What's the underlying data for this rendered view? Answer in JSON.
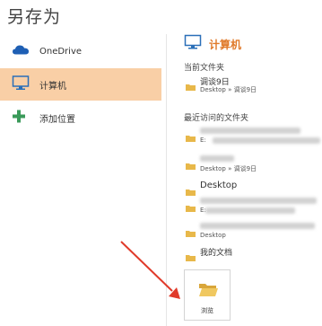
{
  "dialog": {
    "title": "另存为"
  },
  "locations": [
    {
      "label": "OneDrive",
      "icon": "cloud-icon"
    },
    {
      "label": "计算机",
      "icon": "computer-icon",
      "selected": true
    },
    {
      "label": "添加位置",
      "icon": "plus-icon"
    }
  ],
  "right": {
    "header": "计算机",
    "current_label": "当前文件夹",
    "current": {
      "name": "调谈9日",
      "path": "Desktop » 调谈9日"
    },
    "recent_label": "最近访问的文件夹",
    "recent": [
      {
        "name": "",
        "path": "E:"
      },
      {
        "name": "",
        "path": "Desktop » 调谈9日"
      },
      {
        "name": "Desktop",
        "path": ""
      },
      {
        "name": "",
        "path": "E:"
      },
      {
        "name": "",
        "path": "Desktop"
      },
      {
        "name": "我的文档",
        "path": ""
      }
    ],
    "browse_label": "浏览"
  },
  "colors": {
    "accent": "#e07a2a",
    "selected_bg": "#f9cfa6",
    "folder": "#e8b84a",
    "arrow": "#e03a2a"
  }
}
